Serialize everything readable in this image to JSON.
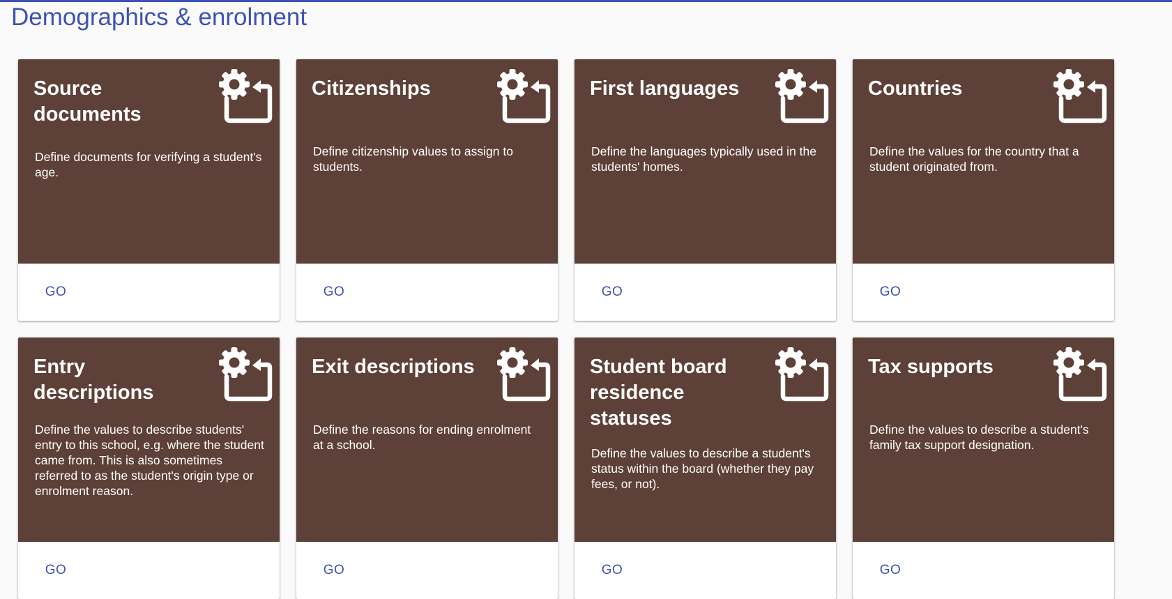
{
  "page": {
    "title": "Demographics & enrolment",
    "accent_color": "#3f51b5",
    "card_color": "#5d4037"
  },
  "cards": [
    {
      "title": "Source documents",
      "description": "Define documents for verifying a student's age.",
      "action_label": "GO",
      "icon": "gear-folder-icon"
    },
    {
      "title": "Citizenships",
      "description": "Define citizenship values to assign to students.",
      "action_label": "GO",
      "icon": "gear-folder-icon"
    },
    {
      "title": "First languages",
      "description": "Define the languages typically used in the students' homes.",
      "action_label": "GO",
      "icon": "gear-folder-icon"
    },
    {
      "title": "Countries",
      "description": "Define the values for the country that a student originated from.",
      "action_label": "GO",
      "icon": "gear-folder-icon"
    },
    {
      "title": "Entry descriptions",
      "description": "Define the values to describe students' entry to this school, e.g. where the student came from. This is also sometimes referred to as the student's origin type or enrolment reason.",
      "action_label": "GO",
      "icon": "gear-folder-icon"
    },
    {
      "title": "Exit descriptions",
      "description": "Define the reasons for ending enrolment at a school.",
      "action_label": "GO",
      "icon": "gear-folder-icon"
    },
    {
      "title": "Student board residence statuses",
      "description": "Define the values to describe a student's status within the board (whether they pay fees, or not).",
      "action_label": "GO",
      "icon": "gear-folder-icon"
    },
    {
      "title": "Tax supports",
      "description": "Define the values to describe a student's family tax support designation.",
      "action_label": "GO",
      "icon": "gear-folder-icon"
    }
  ]
}
